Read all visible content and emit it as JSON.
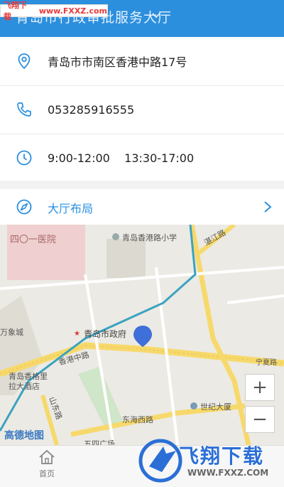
{
  "header": {
    "title": "青岛市行政审批服务大厅",
    "watermark_brand": "飞翔下载",
    "watermark_url": "www.FXXZ.com"
  },
  "info": {
    "address": "青岛市市南区香港中路17号",
    "phone": "053285916555",
    "hours": "9:00-12:00    13:30-17:00"
  },
  "layout_link": {
    "label": "大厅布局"
  },
  "map": {
    "labels": {
      "hospital": "四〇一医院",
      "school": "青岛香港路小学",
      "gov": "青岛市政府",
      "road_hk": "香港中路",
      "road_zhanjiang": "湛江路",
      "wanxiang": "万象城",
      "hotel_line1": "青岛香格里",
      "hotel_line2": "拉大酒店",
      "shandong_rd": "山东路",
      "donghai_rd": "东海西路",
      "century": "世纪大厦",
      "road_right": "宁夏路",
      "provider": "高德地图",
      "bottom_place": "五四广场"
    },
    "zoom_in": "+",
    "zoom_out": "−"
  },
  "tabbar": {
    "home_label": "首页"
  },
  "banner": {
    "brand": "飞翔下载",
    "url": "WWW.FXXZ.COM"
  },
  "colors": {
    "primary": "#2b8fde",
    "map_bg": "#eceae4",
    "road": "#f7d96b",
    "route": "#3aa3c0"
  }
}
